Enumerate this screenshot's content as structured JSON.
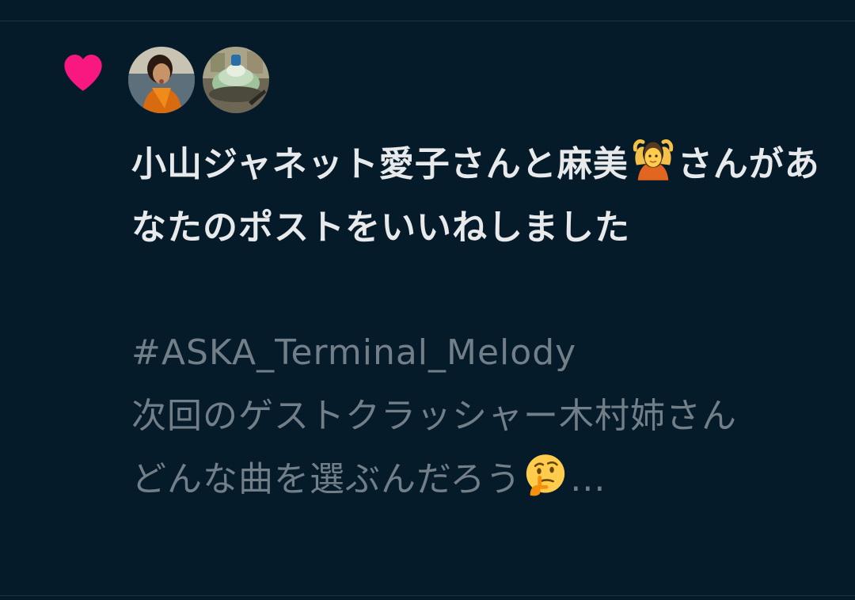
{
  "notification": {
    "type_icon": "heart-icon",
    "accent_color": "#f91880",
    "title": {
      "part1": "小山ジャネット愛子さんと麻美",
      "emoji": "person-gesturing-ok-emoji",
      "part2": "さんがあなたのポストをいいねしました"
    },
    "post": {
      "hashtag": "#ASKA_Terminal_Melody",
      "line2": "次回のゲストクラッシャー木村姉さん",
      "line3_text": "どんな曲を選ぶんだろう",
      "line3_emoji": "thinking-face-emoji",
      "line3_suffix": "..."
    },
    "avatars": [
      {
        "name": "avatar-user-1",
        "kind": "photo-person"
      },
      {
        "name": "avatar-user-2",
        "kind": "photo-object"
      }
    ]
  }
}
